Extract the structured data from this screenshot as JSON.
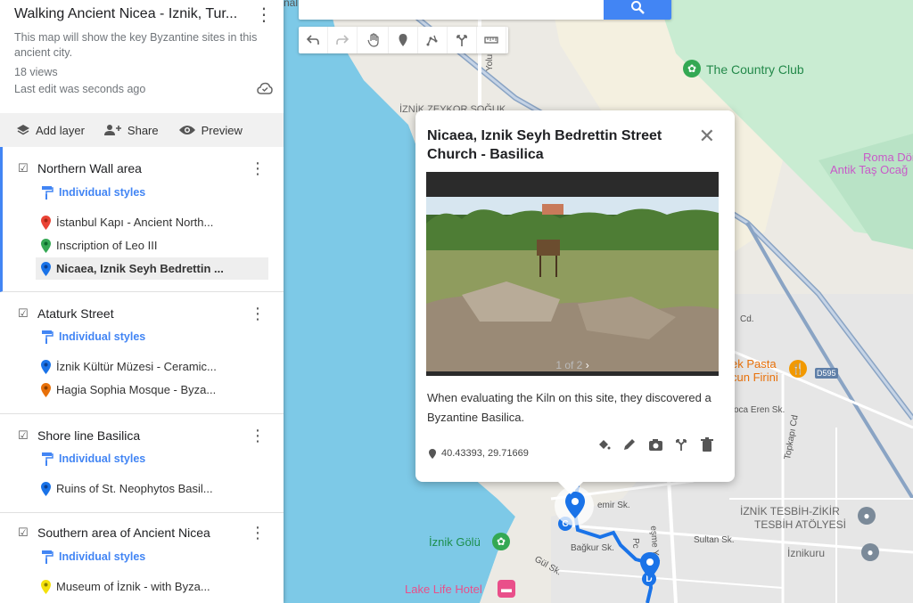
{
  "sidebar": {
    "title": "Walking Ancient Nicea - Iznik, Tur...",
    "description": "This map will show the key Byzantine sites in this ancient city.",
    "views": "18 views",
    "last_edit": "Last edit was seconds ago",
    "actions": {
      "add_layer": "Add layer",
      "share": "Share",
      "preview": "Preview"
    },
    "layers": [
      {
        "name": "Northern Wall area",
        "styles": "Individual styles",
        "items": [
          {
            "label": "İstanbul Kapı - Ancient North...",
            "color": "#ea4335"
          },
          {
            "label": "Inscription of Leo III",
            "color": "#34a853"
          },
          {
            "label": "Nicaea, Iznik Seyh Bedrettin ...",
            "color": "#1a73e8"
          }
        ]
      },
      {
        "name": "Ataturk Street",
        "styles": "Individual styles",
        "items": [
          {
            "label": "İznik Kültür Müzesi - Ceramic...",
            "color": "#1a73e8"
          },
          {
            "label": "Hagia Sophia Mosque - Byza...",
            "color": "#e8710a"
          }
        ]
      },
      {
        "name": "Shore line Basilica",
        "styles": "Individual styles",
        "items": [
          {
            "label": "Ruins of St. Neophytos Basil...",
            "color": "#1a73e8"
          }
        ]
      },
      {
        "name": "Southern area of Ancient Nicea",
        "styles": "Individual styles",
        "items": [
          {
            "label": "Museum of İznik - with Byza...",
            "color": "#f4e10b"
          }
        ]
      }
    ]
  },
  "map": {
    "labels": {
      "country_club": "The Country Club",
      "roma_1": "Roma Dönem",
      "roma_2": "Antik Taş Ocağ",
      "pasta_1": "ek Pasta",
      "pasta_2": "cun Firini",
      "tesbih_1": "İZNİK TESBİH-ZİKİR",
      "tesbih_2": "TESBİH ATÖLYESİ",
      "iznikuru": "İznikuru",
      "iznik_golu": "İznik Gölü",
      "lake_life": "Lake Life Hotel",
      "zeykor": "İZNİK ZEYKOR SOĞUK",
      "top_label": "nal Oğulları"
    },
    "streets": {
      "s1": "Cd.",
      "s2": "oca Eren Sk.",
      "s3": "Topkapı Cd",
      "s4": "emir Sk.",
      "s5": "Sultan Sk.",
      "s6": "Bağkur Sk.",
      "s7": "Gül Sk.",
      "s8": "eşme Yolu",
      "s9": "Yolu",
      "s10": "D595",
      "s11": "Pc"
    },
    "route_markers": {
      "c": "C",
      "d": "D"
    }
  },
  "infowindow": {
    "title": "Nicaea, Iznik Seyh Bedrettin Street Church - Basilica",
    "photo_counter": "1 of 2",
    "description": "When evaluating the Kiln on this site, they discovered a Byzantine Basilica.",
    "coords": "40.43393, 29.71669"
  },
  "colors": {
    "accent": "#4285f4",
    "water": "#7dc9e7",
    "park": "#c9ecd2",
    "route": "#1a73e8"
  }
}
